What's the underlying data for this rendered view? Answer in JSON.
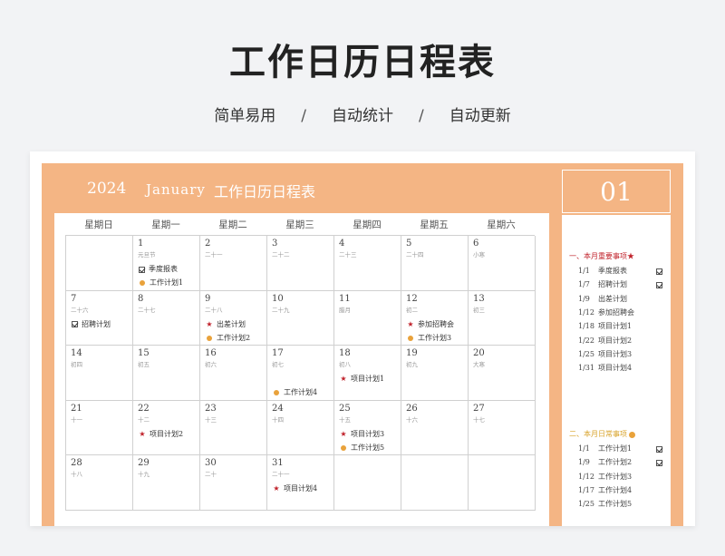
{
  "hero": {
    "title": "工作日历日程表",
    "subtitle": [
      "简单易用",
      "自动统计",
      "自动更新"
    ],
    "separator": "/"
  },
  "header": {
    "year": "2024",
    "month": "January",
    "name": "工作日历日程表"
  },
  "weekdays": [
    "星期日",
    "星期一",
    "星期二",
    "星期三",
    "星期四",
    "星期五",
    "星期六"
  ],
  "days": [
    {
      "n": "",
      "l": ""
    },
    {
      "n": "1",
      "l": "元旦节",
      "e1": {
        "m": "chk",
        "t": "季度报表"
      },
      "e2": {
        "m": "dot",
        "t": "工作计划1"
      }
    },
    {
      "n": "2",
      "l": "二十一"
    },
    {
      "n": "3",
      "l": "二十二"
    },
    {
      "n": "4",
      "l": "二十三"
    },
    {
      "n": "5",
      "l": "二十四"
    },
    {
      "n": "6",
      "l": "小寒"
    },
    {
      "n": "7",
      "l": "二十六",
      "e1": {
        "m": "chk",
        "t": "招聘计划"
      }
    },
    {
      "n": "8",
      "l": "二十七"
    },
    {
      "n": "9",
      "l": "二十八",
      "e1": {
        "m": "star",
        "t": "出差计划"
      },
      "e2": {
        "m": "dot",
        "t": "工作计划2"
      }
    },
    {
      "n": "10",
      "l": "二十九"
    },
    {
      "n": "11",
      "l": "腊月"
    },
    {
      "n": "12",
      "l": "初二",
      "e1": {
        "m": "star",
        "t": "参加招聘会"
      },
      "e2": {
        "m": "dot",
        "t": "工作计划3"
      }
    },
    {
      "n": "13",
      "l": "初三"
    },
    {
      "n": "14",
      "l": "初四"
    },
    {
      "n": "15",
      "l": "初五"
    },
    {
      "n": "16",
      "l": "初六"
    },
    {
      "n": "17",
      "l": "初七",
      "e2": {
        "m": "dot",
        "t": "工作计划4"
      }
    },
    {
      "n": "18",
      "l": "初八",
      "e1": {
        "m": "star",
        "t": "项目计划1"
      }
    },
    {
      "n": "19",
      "l": "初九"
    },
    {
      "n": "20",
      "l": "大寒"
    },
    {
      "n": "21",
      "l": "十一"
    },
    {
      "n": "22",
      "l": "十二",
      "e1": {
        "m": "star",
        "t": "项目计划2"
      }
    },
    {
      "n": "23",
      "l": "十三"
    },
    {
      "n": "24",
      "l": "十四"
    },
    {
      "n": "25",
      "l": "十五",
      "e1": {
        "m": "star",
        "t": "项目计划3"
      },
      "e2": {
        "m": "dot",
        "t": "工作计划5"
      }
    },
    {
      "n": "26",
      "l": "十六"
    },
    {
      "n": "27",
      "l": "十七"
    },
    {
      "n": "28",
      "l": "十八"
    },
    {
      "n": "29",
      "l": "十九"
    },
    {
      "n": "30",
      "l": "二十"
    },
    {
      "n": "31",
      "l": "二十一",
      "e1": {
        "m": "star",
        "t": "项目计划4"
      }
    },
    {
      "n": "",
      "l": ""
    },
    {
      "n": "",
      "l": ""
    },
    {
      "n": "",
      "l": ""
    }
  ],
  "side": {
    "month_num": "01",
    "important_title": "一、本月重要事项★",
    "important": [
      {
        "d": "1/1",
        "t": "季度报表",
        "done": true
      },
      {
        "d": "1/7",
        "t": "招聘计划",
        "done": true
      },
      {
        "d": "1/9",
        "t": "出差计划",
        "done": false
      },
      {
        "d": "1/12",
        "t": "参加招聘会",
        "done": false
      },
      {
        "d": "1/18",
        "t": "项目计划1",
        "done": false
      },
      {
        "d": "1/22",
        "t": "项目计划2",
        "done": false
      },
      {
        "d": "1/25",
        "t": "项目计划3",
        "done": false
      },
      {
        "d": "1/31",
        "t": "项目计划4",
        "done": false
      }
    ],
    "daily_title": "二、本月日常事项",
    "daily": [
      {
        "d": "1/1",
        "t": "工作计划1",
        "done": true
      },
      {
        "d": "1/9",
        "t": "工作计划2",
        "done": true
      },
      {
        "d": "1/12",
        "t": "工作计划3",
        "done": false
      },
      {
        "d": "1/17",
        "t": "工作计划4",
        "done": false
      },
      {
        "d": "1/25",
        "t": "工作计划5",
        "done": false
      }
    ]
  },
  "colors": {
    "accent": "#f4b584",
    "star": "#c0222b",
    "dot": "#e9a23b"
  }
}
